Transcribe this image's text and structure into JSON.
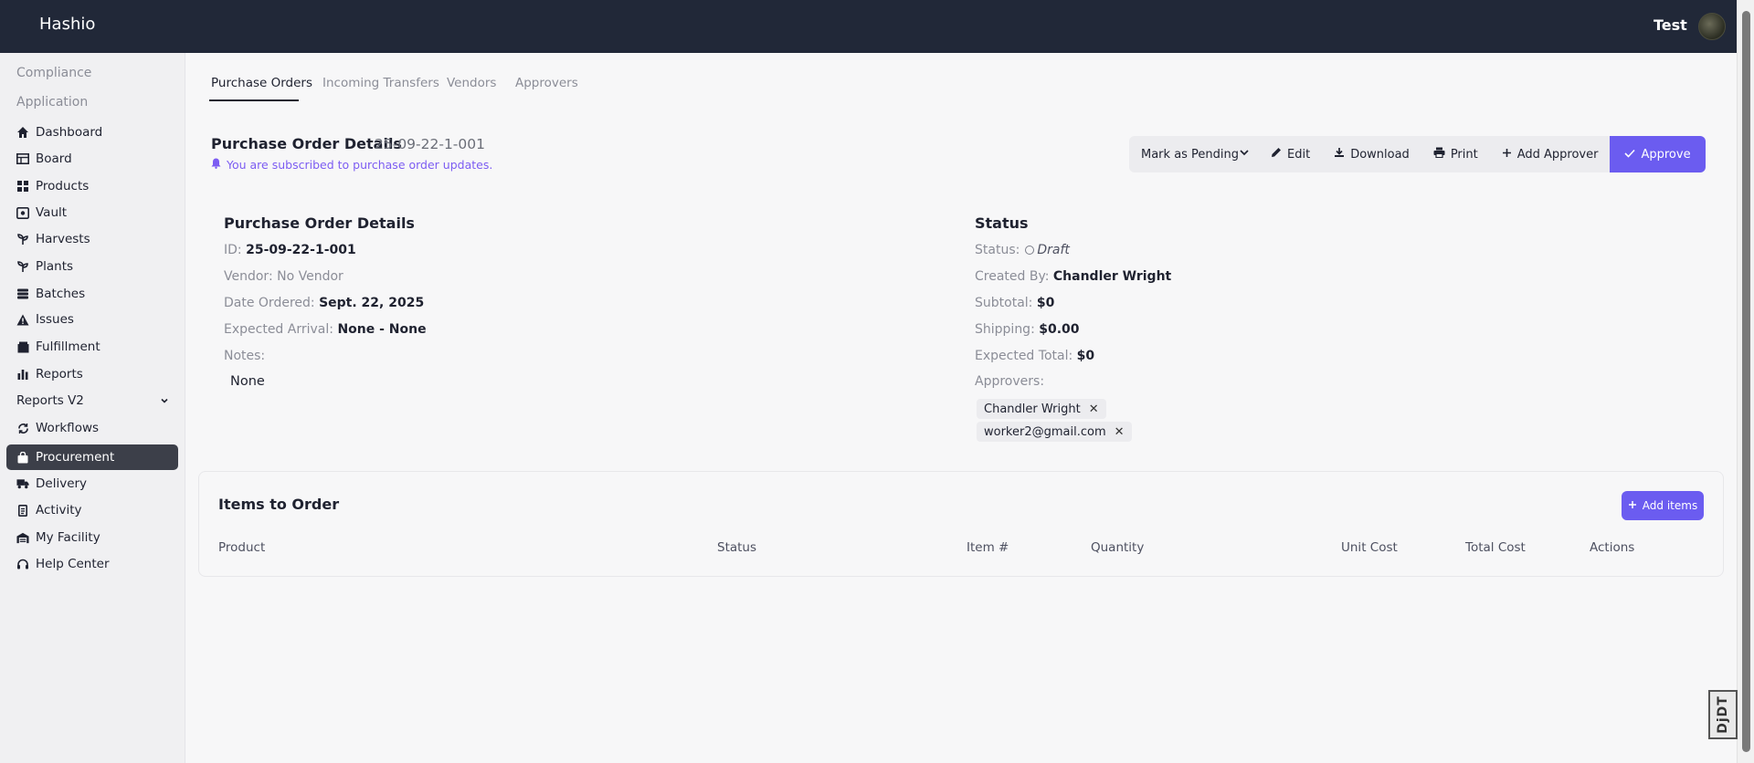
{
  "app": {
    "brand": "Hashio",
    "user_name": "Test"
  },
  "sidebar": {
    "sections": [
      "Compliance",
      "Application"
    ],
    "items": [
      {
        "label": "Dashboard",
        "icon": "home-icon"
      },
      {
        "label": "Board",
        "icon": "board-icon"
      },
      {
        "label": "Products",
        "icon": "products-icon"
      },
      {
        "label": "Vault",
        "icon": "vault-icon"
      },
      {
        "label": "Harvests",
        "icon": "harvest-icon"
      },
      {
        "label": "Plants",
        "icon": "plant-icon"
      },
      {
        "label": "Batches",
        "icon": "batches-icon"
      },
      {
        "label": "Issues",
        "icon": "warning-icon"
      },
      {
        "label": "Fulfillment",
        "icon": "box-icon"
      },
      {
        "label": "Reports",
        "icon": "bar-chart-icon"
      },
      {
        "label": "Reports V2",
        "icon": "chevron-down-icon"
      },
      {
        "label": "Workflows",
        "icon": "workflow-icon"
      },
      {
        "label": "Procurement",
        "icon": "bag-icon"
      },
      {
        "label": "Delivery",
        "icon": "truck-icon"
      },
      {
        "label": "Activity",
        "icon": "clipboard-icon"
      },
      {
        "label": "My Facility",
        "icon": "warehouse-icon"
      },
      {
        "label": "Help Center",
        "icon": "headset-icon"
      }
    ],
    "active": "Procurement"
  },
  "tabs": [
    "Purchase Orders",
    "Incoming Transfers",
    "Vendors",
    "Approvers"
  ],
  "header": {
    "title": "Purchase Order Details",
    "po_number": "25-09-22-1-001",
    "subscribe_note": "You are subscribed to purchase order updates."
  },
  "actions": {
    "status_select": "Mark as Pending",
    "edit": "Edit",
    "download": "Download",
    "print": "Print",
    "add_approver": "Add Approver",
    "approve": "Approve"
  },
  "details": {
    "heading": "Purchase Order Details",
    "id_label": "ID:",
    "id_value": "25-09-22-1-001",
    "vendor_label": "Vendor:",
    "vendor_value": "No Vendor",
    "date_label": "Date Ordered:",
    "date_value": "Sept. 22, 2025",
    "arrival_label": "Expected Arrival:",
    "arrival_value": "None - None",
    "notes_label": "Notes:",
    "notes_value": "None"
  },
  "status": {
    "heading": "Status",
    "status_label": "Status:",
    "status_value": "Draft",
    "created_label": "Created By:",
    "created_value": "Chandler Wright",
    "subtotal_label": "Subtotal:",
    "subtotal_value": "$0",
    "shipping_label": "Shipping:",
    "shipping_value": "$0.00",
    "total_label": "Expected Total:",
    "total_value": "$0",
    "approvers_label": "Approvers:",
    "approvers": [
      "Chandler Wright",
      "worker2@gmail.com"
    ]
  },
  "items": {
    "title": "Items to Order",
    "add_label": "Add items",
    "columns": [
      "Product",
      "Status",
      "Item #",
      "Quantity",
      "Unit Cost",
      "Total Cost",
      "Actions"
    ]
  },
  "badge": "DjDT",
  "colors": {
    "topbar": "#212838",
    "accent": "#6b5cf0",
    "active_nav": "#3c3f49"
  }
}
